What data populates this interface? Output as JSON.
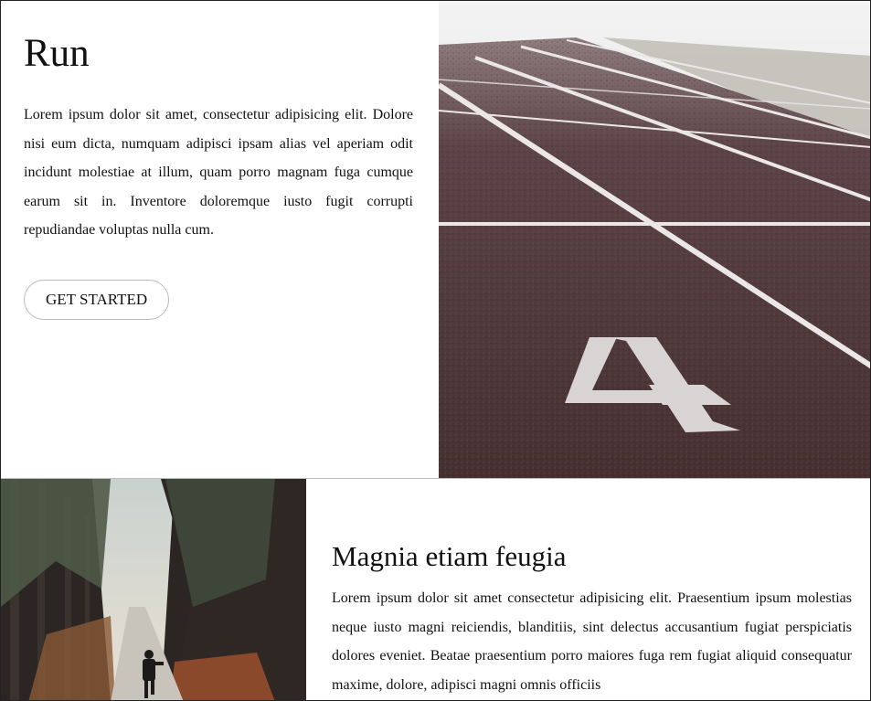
{
  "hero": {
    "title": "Run",
    "body": "Lorem ipsum dolor sit amet, consectetur adipisicing elit. Dolore nisi eum dicta, numquam adipisci ipsam alias vel aperiam odit incidunt molestiae at illum, quam porro magnam fuga cumque earum sit in. Inventore doloremque iusto fugit corrupti repudiandae voluptas nulla cum.",
    "button_label": "GET STARTED",
    "image": {
      "subject": "running-track-lane-4",
      "lane_number": "4",
      "surface_color": "#4a3236",
      "line_color": "#e9e6e6"
    }
  },
  "feature": {
    "title": "Magnia etiam feugia",
    "body": "Lorem ipsum dolor sit amet consectetur adipisicing elit. Praesentium ipsum molestias neque iusto magni reiciendis, blanditiis, sint delectus accusantium fugiat perspiciatis dolores eveniet. Beatae praesentium porro maiores fuga rem fugiat aliquid consequatur maxime, dolore, adipisci magni omnis officiis",
    "image": {
      "subject": "runner-on-forest-path"
    }
  }
}
